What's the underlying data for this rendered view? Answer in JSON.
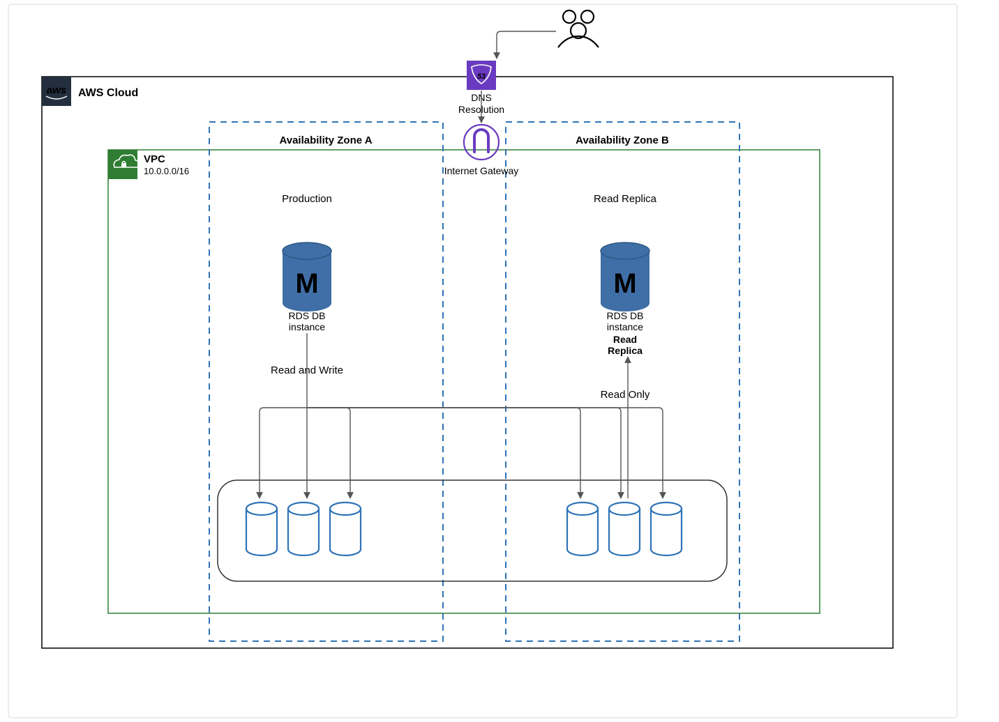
{
  "cloud": {
    "title_label": "AWS Cloud",
    "badge_text": "aws"
  },
  "vpc": {
    "title_label": "VPC",
    "cidr": "10.0.0.0/16"
  },
  "azA": {
    "title_label": "Availability Zone A"
  },
  "azB": {
    "title_label": "Availability Zone B"
  },
  "route53": {
    "label_line1": "DNS",
    "label_line2": "Resolution",
    "badge": "53"
  },
  "igw": {
    "label": "Internet Gateway"
  },
  "production": {
    "section_label": "Production"
  },
  "replica_section": {
    "section_label": "Read Replica"
  },
  "rdsA": {
    "label_line1": "RDS DB",
    "label_line2": "instance",
    "letter": "M"
  },
  "rdsB": {
    "label_line1": "RDS DB",
    "label_line2": "instance",
    "label_line3": "Read",
    "label_line4": "Replica",
    "letter": "M"
  },
  "mode_prod": {
    "label": "Read and Write"
  },
  "mode_replica": {
    "label": "Read Only"
  },
  "colors": {
    "cloud_border": "#000000",
    "aws_badge_bg": "#232f3e",
    "vpc_border": "#2e7d32",
    "vpc_badge_bg": "#2e7d32",
    "az_border": "#2f73b7",
    "route53_bg": "#6a3bc0",
    "igw_stroke": "#6a3bc0",
    "rds_blue": "#3f6fa6",
    "disk_blue": "#2f73b7",
    "arrow": "#555555"
  }
}
